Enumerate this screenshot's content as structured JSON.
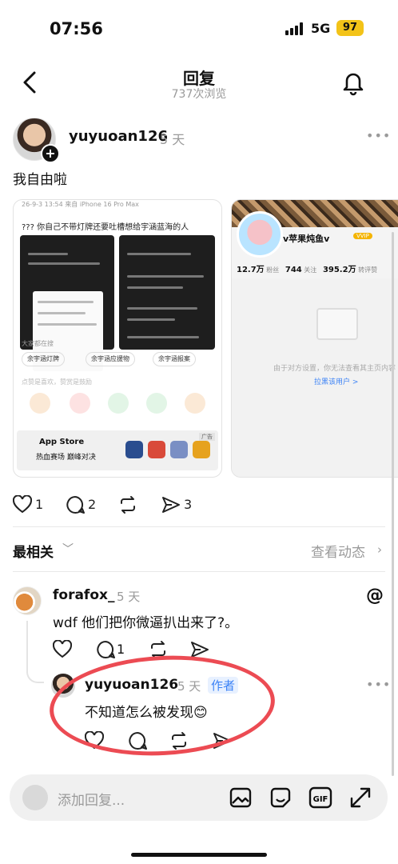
{
  "status": {
    "time": "07:56",
    "network": "5G",
    "battery": "97"
  },
  "nav": {
    "title": "回复",
    "subtitle": "737次浏览"
  },
  "post": {
    "username": "yuyuoan126",
    "time": "5 天",
    "text": "我自由啦",
    "likes": "1",
    "comments": "2",
    "shares": "3"
  },
  "card1": {
    "header": "26-9-3 13:54 来自 iPhone 16 Pro Max",
    "question": "??? 你自己不带灯牌还要吐槽想给宇涵蓝海的人",
    "section": "大家都在搜",
    "chips": [
      "余宇涵灯牌",
      "余宇涵应援物",
      "余宇涵报案"
    ],
    "hint": "点赞是喜欢，赞赏是鼓励",
    "ad_store": "App Store",
    "ad_sub": "热血赛场 巅峰对决",
    "ad_tag": "广告"
  },
  "card2": {
    "name": "v苹果炖鱼v",
    "vip": "VVIP",
    "fans": "12.7万",
    "fans_label": "粉丝",
    "follow": "744",
    "follow_label": "关注",
    "likes": "395.2万",
    "likes_label": "转评赞",
    "message": "由于对方设置，你无法查看其主页内容",
    "link": "拉黑该用户 >"
  },
  "sort": {
    "label": "最相关",
    "view_activity": "查看动态"
  },
  "comment": {
    "username": "forafox_",
    "time": "5 天",
    "text": "wdf 他们把你微逼扒出来了?。",
    "comments": "1"
  },
  "reply": {
    "username": "yuyuoan126",
    "time": "5 天",
    "author_tag": "作者",
    "text": "不知道怎么被发现😊"
  },
  "input": {
    "placeholder": "添加回复..."
  },
  "colors": {
    "accent": "#3b82f6",
    "annotation": "#ec4b53",
    "battery": "#f3c318"
  }
}
